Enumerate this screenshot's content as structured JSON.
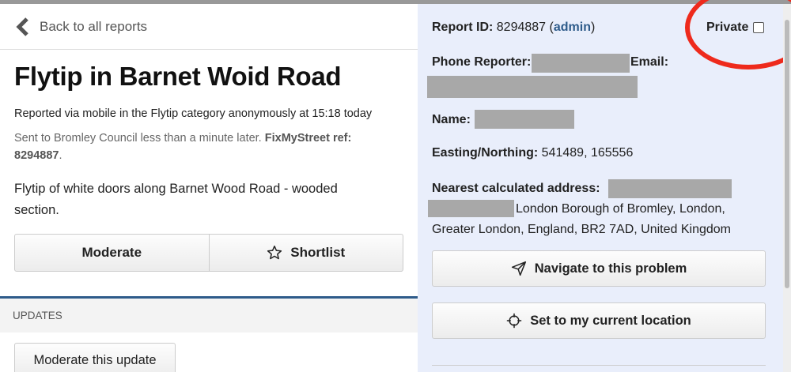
{
  "back": {
    "label": "Back to all reports"
  },
  "report": {
    "title": "Flytip in Barnet Woid Road",
    "meta": "Reported via mobile in the Flytip category anonymously at 15:18 today",
    "sent_prefix": "Sent to Bromley Council less than a minute later. ",
    "sent_ref_label": "FixMyStreet ref: 8294887",
    "sent_suffix": ".",
    "description": "Flytip of white doors along Barnet Wood Road - wooded section."
  },
  "actions": {
    "moderate": "Moderate",
    "shortlist": "Shortlist"
  },
  "updates": {
    "heading": "UPDATES",
    "moderate_update": "Moderate this update"
  },
  "sidebar": {
    "report_id_label": "Report ID:",
    "report_id": "8294887",
    "admin_open": "(",
    "admin_link": "admin",
    "admin_close": ")",
    "private_label": "Private",
    "private_checked": false,
    "phone_label": "Phone Reporter:",
    "email_label": "Email:",
    "name_label": "Name:",
    "easting_label": "Easting/Northing:",
    "easting_value": "541489, 165556",
    "address_label": "Nearest calculated address:",
    "address_line1": "London Borough of Bromley, London,",
    "address_line2": "Greater London, England, BR2 7AD, United Kingdom",
    "navigate": "Navigate to this problem",
    "set_location": "Set to my current location"
  },
  "colors": {
    "accent": "#2e5b8a",
    "annotation": "#ee2a1c",
    "sidebar_bg": "#e9eefb",
    "redaction": "#a8a8a8"
  }
}
